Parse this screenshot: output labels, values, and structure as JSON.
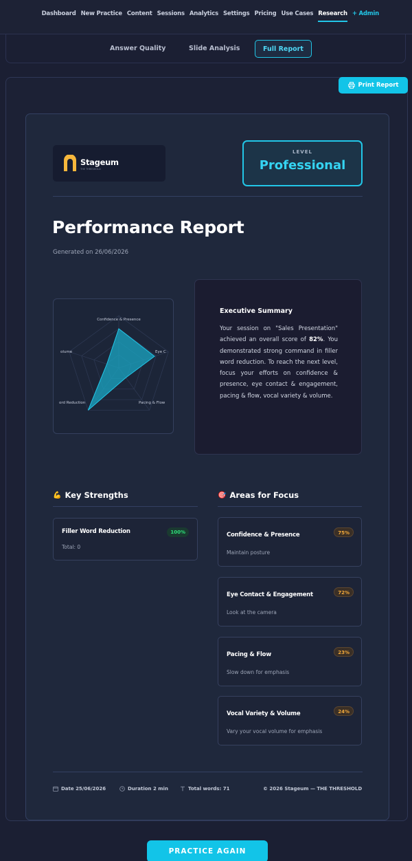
{
  "nav": {
    "items": [
      "Dashboard",
      "New Practice",
      "Content",
      "Sessions",
      "Analytics",
      "Settings",
      "Pricing",
      "Use Cases",
      "Research"
    ],
    "active": "Research",
    "admin": "+ Admin"
  },
  "subtabs": [
    "Answer Quality",
    "Slide Analysis",
    "Full Report"
  ],
  "print_button": "Print Report",
  "report": {
    "logo_name": "Stageum",
    "logo_tagline": "THE THRESHOLD",
    "level_label": "LEVEL",
    "level_value": "Professional",
    "title": "Performance Report",
    "generated": "Generated on 26/06/2026"
  },
  "radar": {
    "labels": [
      "Confidence & Presence",
      "Eye C",
      "Pacing & Flow",
      "ord Reduction",
      "olume"
    ],
    "values": [
      0.75,
      0.72,
      0.23,
      1.0,
      0.24
    ]
  },
  "summary": {
    "title": "Executive Summary",
    "text_pre": "Your session on \"Sales Presentation\" achieved an overall score of ",
    "score": "82%",
    "text_post": ". You demonstrated strong command in filler word reduction. To reach the next level, focus your efforts on confidence & presence, eye contact & engagement, pacing & flow, vocal variety & volume."
  },
  "strengths": {
    "title": "Key Strengths",
    "items": [
      {
        "name": "Filler Word Reduction",
        "score": "100%",
        "detail": "Total: 0"
      }
    ]
  },
  "focus": {
    "title": "Areas for Focus",
    "items": [
      {
        "name": "Confidence & Presence",
        "score": "75%",
        "detail": "Maintain posture"
      },
      {
        "name": "Eye Contact & Engagement",
        "score": "72%",
        "detail": "Look at the camera"
      },
      {
        "name": "Pacing & Flow",
        "score": "23%",
        "detail": "Slow down for emphasis"
      },
      {
        "name": "Vocal Variety & Volume",
        "score": "24%",
        "detail": "Vary your vocal volume for emphasis"
      }
    ]
  },
  "footer": {
    "date": "Date 25/06/2026",
    "duration": "Duration 2 min",
    "words": "Total words: 71",
    "copyright": "© 2026 Stageum — THE THRESHOLD"
  },
  "practice_button": "PRACTICE AGAIN"
}
